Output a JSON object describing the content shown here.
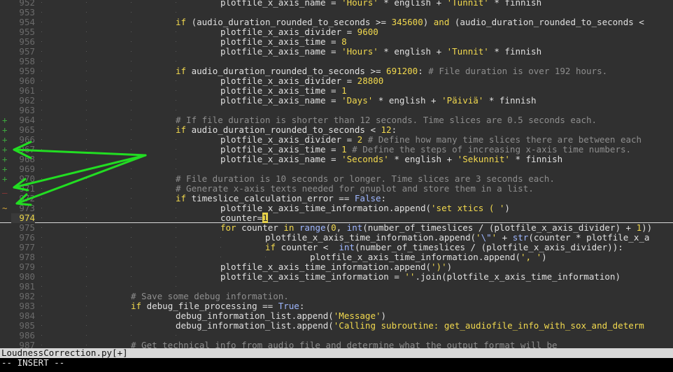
{
  "editor": {
    "filename": "LoudnessCorrection.py[+]",
    "mode": "-- INSERT --",
    "current_line": 974,
    "lines": [
      {
        "n": 952,
        "sign": "",
        "indent": 4,
        "tokens": [
          [
            "t",
            "plotfile_x_axis_name = "
          ],
          [
            "s",
            "'Hours'"
          ],
          [
            "t",
            " * english + "
          ],
          [
            "s",
            "'Tunnit'"
          ],
          [
            "t",
            " * finnish"
          ]
        ]
      },
      {
        "n": 953,
        "sign": "",
        "indent": 0,
        "tokens": []
      },
      {
        "n": 954,
        "sign": "",
        "indent": 3,
        "tokens": [
          [
            "k",
            "if"
          ],
          [
            "t",
            " (audio_duration_rounded_to_seconds >= "
          ],
          [
            "n",
            "345600"
          ],
          [
            "t",
            ") "
          ],
          [
            "k",
            "and"
          ],
          [
            "t",
            " (audio_duration_rounded_to_seconds <"
          ]
        ]
      },
      {
        "n": 955,
        "sign": "",
        "indent": 4,
        "tokens": [
          [
            "t",
            "plotfile_x_axis_divider = "
          ],
          [
            "n",
            "9600"
          ]
        ]
      },
      {
        "n": 956,
        "sign": "",
        "indent": 4,
        "tokens": [
          [
            "t",
            "plotfile_x_axis_time = "
          ],
          [
            "n",
            "8"
          ]
        ]
      },
      {
        "n": 957,
        "sign": "",
        "indent": 4,
        "tokens": [
          [
            "t",
            "plotfile_x_axis_name = "
          ],
          [
            "s",
            "'Hours'"
          ],
          [
            "t",
            " * english + "
          ],
          [
            "s",
            "'Tunnit'"
          ],
          [
            "t",
            " * finnish"
          ]
        ]
      },
      {
        "n": 958,
        "sign": "",
        "indent": 0,
        "tokens": []
      },
      {
        "n": 959,
        "sign": "",
        "indent": 3,
        "tokens": [
          [
            "k",
            "if"
          ],
          [
            "t",
            " audio_duration_rounded_to_seconds >= "
          ],
          [
            "n",
            "691200"
          ],
          [
            "t",
            ": "
          ],
          [
            "c",
            "# File duration is over 192 hours."
          ]
        ]
      },
      {
        "n": 960,
        "sign": "",
        "indent": 4,
        "tokens": [
          [
            "t",
            "plotfile_x_axis_divider = "
          ],
          [
            "n",
            "28800"
          ]
        ]
      },
      {
        "n": 961,
        "sign": "",
        "indent": 4,
        "tokens": [
          [
            "t",
            "plotfile_x_axis_time = "
          ],
          [
            "n",
            "1"
          ]
        ]
      },
      {
        "n": 962,
        "sign": "",
        "indent": 4,
        "tokens": [
          [
            "t",
            "plotfile_x_axis_name = "
          ],
          [
            "s",
            "'Days'"
          ],
          [
            "t",
            " * english + "
          ],
          [
            "s",
            "'Päiviä'"
          ],
          [
            "t",
            " * finnish"
          ]
        ]
      },
      {
        "n": 963,
        "sign": "",
        "indent": 0,
        "tokens": []
      },
      {
        "n": 964,
        "sign": "+",
        "indent": 3,
        "tokens": [
          [
            "c",
            "# If file duration is shorter than 12 seconds. Time slices are 0.5 seconds each."
          ]
        ]
      },
      {
        "n": 965,
        "sign": "+",
        "indent": 3,
        "tokens": [
          [
            "k",
            "if"
          ],
          [
            "t",
            " audio_duration_rounded_to_seconds < "
          ],
          [
            "n",
            "12"
          ],
          [
            "t",
            ":"
          ]
        ]
      },
      {
        "n": 966,
        "sign": "+",
        "indent": 4,
        "tokens": [
          [
            "t",
            "plotfile_x_axis_divider = "
          ],
          [
            "n",
            "2"
          ],
          [
            "t",
            " "
          ],
          [
            "c",
            "# Define how many time slices there are between each"
          ]
        ]
      },
      {
        "n": 967,
        "sign": "+",
        "indent": 4,
        "tokens": [
          [
            "t",
            "plotfile_x_axis_time = "
          ],
          [
            "n",
            "1"
          ],
          [
            "t",
            " "
          ],
          [
            "c",
            "# Define the steps of increasing x-axis time numbers."
          ]
        ]
      },
      {
        "n": 968,
        "sign": "+",
        "indent": 4,
        "tokens": [
          [
            "t",
            "plotfile_x_axis_name = "
          ],
          [
            "s",
            "'Seconds'"
          ],
          [
            "t",
            " * english + "
          ],
          [
            "s",
            "'Sekunnit'"
          ],
          [
            "t",
            " * finnish"
          ]
        ]
      },
      {
        "n": 969,
        "sign": "+",
        "indent": 0,
        "tokens": []
      },
      {
        "n": 970,
        "sign": "+",
        "indent": 3,
        "tokens": [
          [
            "c",
            "# File duration is 10 seconds or longer. Time slices are 3 seconds each."
          ]
        ]
      },
      {
        "n": 971,
        "sign": "_",
        "indent": 3,
        "tokens": [
          [
            "c",
            "# Generate x-axis texts needed for gnuplot and store them in a list."
          ]
        ]
      },
      {
        "n": 972,
        "sign": "",
        "indent": 3,
        "tokens": [
          [
            "k",
            "if"
          ],
          [
            "t",
            " timeslice_calculation_error == "
          ],
          [
            "b",
            "False"
          ],
          [
            "t",
            ":"
          ]
        ]
      },
      {
        "n": 973,
        "sign": "~",
        "indent": 4,
        "tokens": [
          [
            "t",
            "plotfile_x_axis_time_information.append("
          ],
          [
            "s",
            "'set xtics ( '"
          ],
          [
            "t",
            ")"
          ]
        ]
      },
      {
        "n": 974,
        "sign": "",
        "indent": 4,
        "tokens": [
          [
            "t",
            "counter="
          ],
          [
            "cur",
            "1"
          ]
        ]
      },
      {
        "n": 975,
        "sign": "",
        "indent": 4,
        "tokens": [
          [
            "k",
            "for"
          ],
          [
            "t",
            " counter "
          ],
          [
            "k",
            "in"
          ],
          [
            "t",
            " "
          ],
          [
            "b",
            "range"
          ],
          [
            "t",
            "("
          ],
          [
            "n",
            "0"
          ],
          [
            "t",
            ", "
          ],
          [
            "b",
            "int"
          ],
          [
            "t",
            "(number_of_timeslices / (plotfile_x_axis_divider) + "
          ],
          [
            "n",
            "1"
          ],
          [
            "t",
            "))"
          ]
        ]
      },
      {
        "n": 976,
        "sign": "",
        "indent": 5,
        "tokens": [
          [
            "t",
            "plotfile_x_axis_time_information.append("
          ],
          [
            "s",
            "'"
          ],
          [
            "p",
            "\\\""
          ],
          [
            "s",
            "'"
          ],
          [
            "t",
            " + "
          ],
          [
            "b",
            "str"
          ],
          [
            "t",
            "(counter * plotfile_x_a"
          ]
        ]
      },
      {
        "n": 977,
        "sign": "",
        "indent": 5,
        "tokens": [
          [
            "k",
            "if"
          ],
          [
            "t",
            " counter <  "
          ],
          [
            "b",
            "int"
          ],
          [
            "t",
            "(number_of_timeslices / (plotfile_x_axis_divider)):"
          ]
        ]
      },
      {
        "n": 978,
        "sign": "",
        "indent": 6,
        "tokens": [
          [
            "t",
            "plotfile_x_axis_time_information.append("
          ],
          [
            "s",
            "', '"
          ],
          [
            "t",
            ")"
          ]
        ]
      },
      {
        "n": 979,
        "sign": "",
        "indent": 4,
        "tokens": [
          [
            "t",
            "plotfile_x_axis_time_information.append("
          ],
          [
            "s",
            "')'"
          ],
          [
            "t",
            ")"
          ]
        ]
      },
      {
        "n": 980,
        "sign": "",
        "indent": 4,
        "tokens": [
          [
            "t",
            "plotfile_x_axis_time_information = "
          ],
          [
            "s",
            "''"
          ],
          [
            "t",
            ".join(plotfile_x_axis_time_information)"
          ]
        ]
      },
      {
        "n": 981,
        "sign": "",
        "indent": 0,
        "tokens": []
      },
      {
        "n": 982,
        "sign": "",
        "indent": 2,
        "tokens": [
          [
            "c",
            "# Save some debug information."
          ]
        ]
      },
      {
        "n": 983,
        "sign": "",
        "indent": 2,
        "tokens": [
          [
            "k",
            "if"
          ],
          [
            "t",
            " debug_file_processing == "
          ],
          [
            "b",
            "True"
          ],
          [
            "t",
            ":"
          ]
        ]
      },
      {
        "n": 984,
        "sign": "",
        "indent": 3,
        "tokens": [
          [
            "t",
            "debug_information_list.append("
          ],
          [
            "s",
            "'Message'"
          ],
          [
            "t",
            ")"
          ]
        ]
      },
      {
        "n": 985,
        "sign": "",
        "indent": 3,
        "tokens": [
          [
            "t",
            "debug_information_list.append("
          ],
          [
            "s",
            "'Calling subroutine: get_audiofile_info_with_sox_and_determ"
          ]
        ]
      },
      {
        "n": 986,
        "sign": "",
        "indent": 0,
        "tokens": []
      },
      {
        "n": 987,
        "sign": "",
        "indent": 2,
        "tokens": [
          [
            "c",
            "# Get technical info from audio file and determine what the output format will be"
          ]
        ]
      }
    ]
  },
  "colors": {
    "background": "#303030",
    "keyword": "#f2d94e",
    "string": "#f2d94e",
    "comment": "#8e8e8e",
    "builtin": "#9fb7ff",
    "added_sign": "#3ea63e",
    "removed_sign": "#d83a3a",
    "annotation_arrows": "#22dd22"
  }
}
